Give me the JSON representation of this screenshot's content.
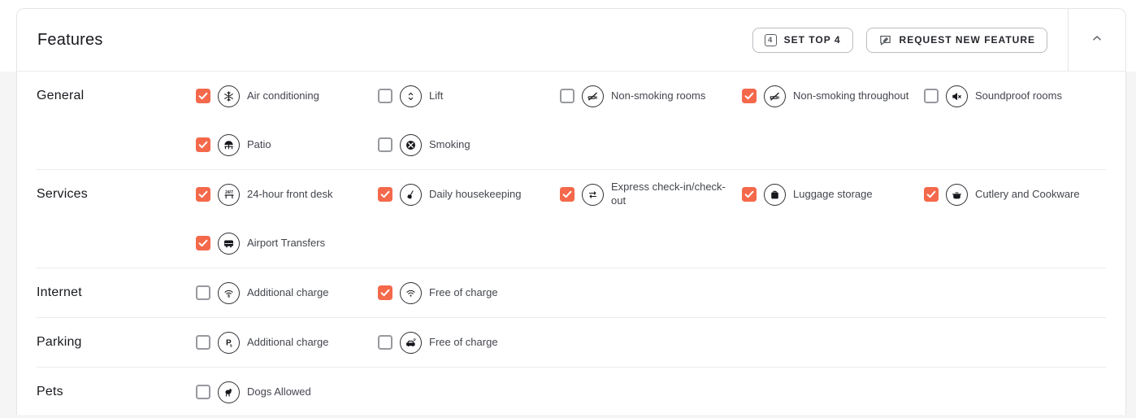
{
  "header": {
    "title": "Features",
    "buttons": [
      {
        "label": "SET TOP 4",
        "icon": "top-4-icon"
      },
      {
        "label": "REQUEST NEW FEATURE",
        "icon": "feedback-pencil-icon"
      }
    ],
    "collapse_icon": "chevron-up-icon"
  },
  "colors": {
    "accent": "#F4694B",
    "checkbox_border": "#97999E",
    "icon_stroke": "#17181C",
    "label_text": "#43464D",
    "heading_text": "#17191E",
    "card_border": "#E4E5E8",
    "page_background": "#F5F5F6"
  },
  "sections": [
    {
      "label": "General",
      "features": [
        {
          "label": "Air conditioning",
          "checked": true,
          "icon": "snowflake-icon"
        },
        {
          "label": "Lift",
          "checked": false,
          "icon": "lift-arrows-icon"
        },
        {
          "label": "Non-smoking rooms",
          "checked": false,
          "icon": "no-smoking-icon"
        },
        {
          "label": "Non-smoking throughout",
          "checked": true,
          "icon": "no-smoking-icon"
        },
        {
          "label": "Soundproof rooms",
          "checked": false,
          "icon": "speaker-mute-icon"
        },
        {
          "label": "Patio",
          "checked": true,
          "icon": "patio-umbrella-icon"
        },
        {
          "label": "Smoking",
          "checked": false,
          "icon": "smoking-ban-icon"
        }
      ]
    },
    {
      "label": "Services",
      "features": [
        {
          "label": "24-hour front desk",
          "checked": true,
          "icon": "front-desk-24-7-icon"
        },
        {
          "label": "Daily housekeeping",
          "checked": true,
          "icon": "housekeeping-broom-icon"
        },
        {
          "label": "Express check-in/check-out",
          "checked": true,
          "icon": "express-arrows-icon"
        },
        {
          "label": "Luggage storage",
          "checked": true,
          "icon": "luggage-icon"
        },
        {
          "label": "Cutlery and Cookware",
          "checked": true,
          "icon": "cookware-pot-icon"
        },
        {
          "label": "Airport Transfers",
          "checked": true,
          "icon": "shuttle-bus-icon"
        }
      ]
    },
    {
      "label": "Internet",
      "features": [
        {
          "label": "Additional charge",
          "checked": false,
          "icon": "wifi-paid-icon"
        },
        {
          "label": "Free of charge",
          "checked": true,
          "icon": "wifi-icon"
        }
      ]
    },
    {
      "label": "Parking",
      "features": [
        {
          "label": "Additional charge",
          "checked": false,
          "icon": "parking-paid-icon"
        },
        {
          "label": "Free of charge",
          "checked": false,
          "icon": "parking-car-icon"
        }
      ]
    },
    {
      "label": "Pets",
      "features": [
        {
          "label": "Dogs Allowed",
          "checked": false,
          "icon": "dog-icon"
        }
      ]
    }
  ]
}
